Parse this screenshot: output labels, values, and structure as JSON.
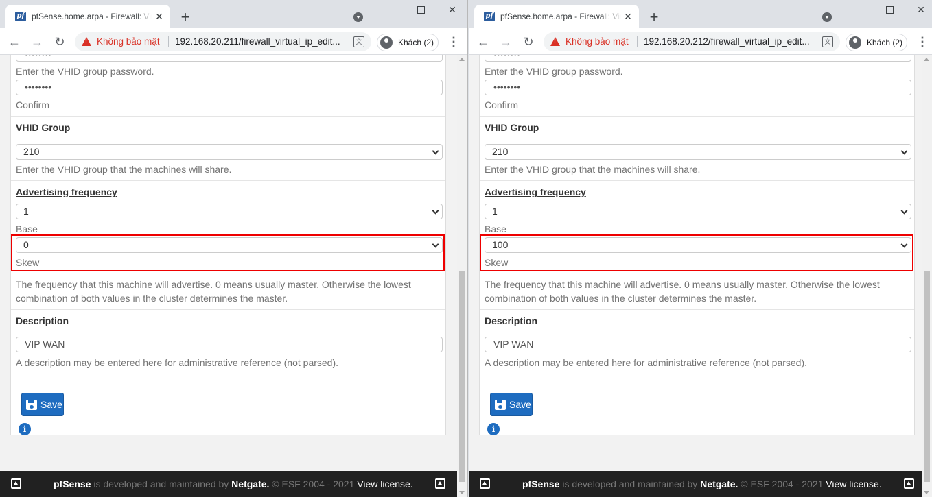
{
  "browser": {
    "tab_title": "pfSense.home.arpa - Firewall: Virtual IPs: Edit",
    "tab_close": "✕",
    "new_tab": "+",
    "security_label": "Không bảo mật",
    "profile_label": "Khách (2)",
    "favicon_text": "pf"
  },
  "windows": [
    {
      "url": "192.168.20.211/firewall_virtual_ip_edit...",
      "form": {
        "password_value": "••••••••",
        "password_help": "Enter the VHID group password.",
        "confirm_value": "••••••••",
        "confirm_help": "Confirm",
        "vhid_label": "VHID Group",
        "vhid_value": "210",
        "vhid_help": "Enter the VHID group that the machines will share.",
        "adv_label": "Advertising frequency",
        "base_value": "1",
        "base_help": "Base",
        "skew_value": "0",
        "skew_help": "Skew",
        "adv_help": "The frequency that this machine will advertise. 0 means usually master. Otherwise the lowest combination of both values in the cluster determines the master.",
        "desc_label": "Description",
        "desc_value": "VIP WAN",
        "desc_help": "A description may be entered here for administrative reference (not parsed).",
        "save_label": "Save"
      }
    },
    {
      "url": "192.168.20.212/firewall_virtual_ip_edit...",
      "form": {
        "password_value": "••••••••",
        "password_help": "Enter the VHID group password.",
        "confirm_value": "••••••••",
        "confirm_help": "Confirm",
        "vhid_label": "VHID Group",
        "vhid_value": "210",
        "vhid_help": "Enter the VHID group that the machines will share.",
        "adv_label": "Advertising frequency",
        "base_value": "1",
        "base_help": "Base",
        "skew_value": "100",
        "skew_help": "Skew",
        "adv_help": "The frequency that this machine will advertise. 0 means usually master. Otherwise the lowest combination of both values in the cluster determines the master.",
        "desc_label": "Description",
        "desc_value": "VIP WAN",
        "desc_help": "A description may be entered here for administrative reference (not parsed).",
        "save_label": "Save"
      }
    }
  ],
  "footer": {
    "brand": "pfSense",
    "text1": " is developed and maintained by ",
    "company": "Netgate.",
    "text2": " © ESF 2004 - 2021 ",
    "license": "View license."
  },
  "icons": {
    "back": "back-arrow-icon",
    "forward": "forward-arrow-icon",
    "reload": "reload-icon",
    "warning": "warning-triangle-icon",
    "translate": "translate-icon",
    "save": "floppy-disk-icon",
    "info": "info-circle-icon"
  },
  "colors": {
    "highlight": "#ee0000",
    "save_button": "#1e6cc0",
    "footer_bg": "#212121",
    "insecure_red": "#d93025"
  }
}
